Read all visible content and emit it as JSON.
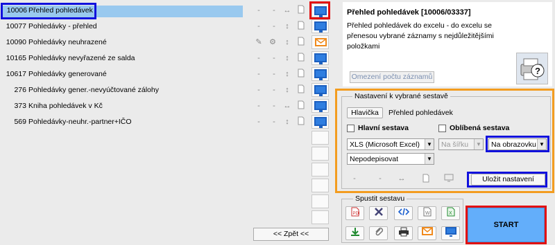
{
  "reports": [
    {
      "num": "10006",
      "title": "Přehled pohledávek",
      "tools": [
        "-",
        "-",
        "↔",
        "pdf"
      ],
      "output": "monitor"
    },
    {
      "num": "10077",
      "title": "Pohledávky - přehled",
      "tools": [
        "-",
        "-",
        "↕",
        "pdf"
      ],
      "output": "monitor"
    },
    {
      "num": "10090",
      "title": "Pohledávky neuhrazené",
      "tools": [
        "✎",
        "⚙",
        "↕",
        "pdf"
      ],
      "output": "email"
    },
    {
      "num": "10165",
      "title": "Pohledávky nevyřazené ze salda",
      "tools": [
        "-",
        "-",
        "↕",
        "pdf"
      ],
      "output": "monitor"
    },
    {
      "num": "10617",
      "title": "Pohledávky generované",
      "tools": [
        "-",
        "-",
        "↕",
        "pdf"
      ],
      "output": "monitor"
    },
    {
      "num": "276",
      "title": "Pohledávky gener.-nevyúčtované zálohy",
      "tools": [
        "-",
        "-",
        "↕",
        "pdf"
      ],
      "output": "monitor"
    },
    {
      "num": "373",
      "title": "Kniha pohledávek v Kč",
      "tools": [
        "-",
        "-",
        "↔",
        "pdf"
      ],
      "output": "monitor"
    },
    {
      "num": "569",
      "title": "Pohledávky-neuhr.-partner+IČO",
      "tools": [
        "-",
        "-",
        "↕",
        "pdf"
      ],
      "output": "monitor"
    }
  ],
  "back_label": "<< Zpět <<",
  "info": {
    "title": "Přehled pohledávek [10006/03337]",
    "description": "Přehled pohledávek do excelu - do excelu se přenesou vybrané záznamy s nejdůležitějšími položkami",
    "limit_button": "Omezení počtu záznamů"
  },
  "settings": {
    "legend": "Nastavení k vybrané sestavě",
    "header_button": "Hlavička",
    "header_value": "Přehled pohledávek",
    "main_report_label": "Hlavní sestava",
    "favorite_label": "Oblíbená sestava",
    "format": "XLS (Microsoft Excel)",
    "orientation": "Na šířku",
    "destination": "Na obrazovku",
    "signature": "Nepodepisovat",
    "tools": [
      "-",
      "-",
      "↔",
      "pdf"
    ],
    "save_button": "Uložit nastavení"
  },
  "run": {
    "legend": "Spustit sestavu",
    "start_label": "START"
  },
  "colors": {
    "orange": "#f39c1f",
    "blue_highlight": "#1111dd",
    "red_highlight": "#e21010",
    "start_bg": "#63aefa"
  }
}
